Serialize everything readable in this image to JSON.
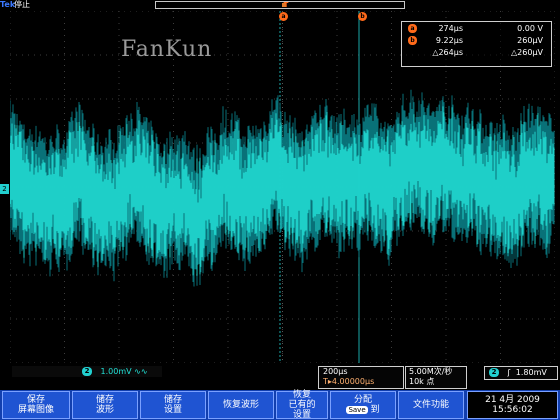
{
  "topbar": {
    "brand": "Tek",
    "run_state": "停止"
  },
  "markers": {
    "cursor_a": "a",
    "cursor_b": "b",
    "trigger_marker": "T",
    "channel_ref": "2"
  },
  "readout": {
    "row1": {
      "icon": "a",
      "left": "274µs",
      "right": "0.00 V"
    },
    "row2": {
      "icon": "b",
      "left": "9.22µs",
      "right": "260µV"
    },
    "row3": {
      "left": "△264µs",
      "right": "△260µV"
    }
  },
  "watermark": "FanKun",
  "statusbar": {
    "channel": {
      "chip": "2",
      "scale": "1.00mV",
      "coupling_symbol": "∿∿"
    },
    "timebase": {
      "time_div": "200µs",
      "trigger_pos": "T▸4.00000µs"
    },
    "acquisition": {
      "rate": "5.00M次/秒",
      "points": "10k 点"
    },
    "trigger": {
      "chip": "2",
      "slope": "ʃ",
      "level": "1.80mV"
    }
  },
  "softkeys": [
    {
      "line1": "保存",
      "line2": "屏幕图像"
    },
    {
      "line1": "储存",
      "line2": "波形"
    },
    {
      "line1": "储存",
      "line2": "设置"
    },
    {
      "line1": "恢复波形",
      "line2": ""
    },
    {
      "line1": "恢复",
      "line2": "已有的",
      "line3": "设置"
    },
    {
      "line1": "分配",
      "line2": "Save",
      "line3": "到"
    },
    {
      "line1": "文件功能",
      "line2": ""
    }
  ],
  "datetime": {
    "date": "21 4月 2009",
    "time": "15:56:02"
  },
  "colors": {
    "trace": "#22e0d6",
    "trace_dark": "#0b7e86",
    "cursor": "#ff6a1a",
    "softkey_bg": "#1f54d2",
    "brand": "#3a78ff"
  }
}
